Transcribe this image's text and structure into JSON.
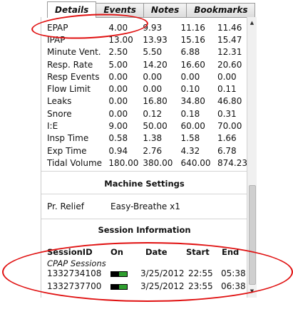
{
  "tabs": [
    "Details",
    "Events",
    "Notes",
    "Bookmarks"
  ],
  "stats": [
    {
      "label": "EPAP",
      "values": [
        "4.00",
        "9.93",
        "11.16",
        "11.46"
      ]
    },
    {
      "label": "IPAP",
      "values": [
        "13.00",
        "13.93",
        "15.16",
        "15.47"
      ]
    },
    {
      "label": "Minute Vent.",
      "values": [
        "2.50",
        "5.50",
        "6.88",
        "12.31"
      ]
    },
    {
      "label": "Resp. Rate",
      "values": [
        "5.00",
        "14.20",
        "16.60",
        "20.60"
      ]
    },
    {
      "label": "Resp Events",
      "values": [
        "0.00",
        "0.00",
        "0.00",
        "0.00"
      ]
    },
    {
      "label": "Flow Limit",
      "values": [
        "0.00",
        "0.00",
        "0.10",
        "0.11"
      ]
    },
    {
      "label": "Leaks",
      "values": [
        "0.00",
        "16.80",
        "34.80",
        "46.80"
      ]
    },
    {
      "label": "Snore",
      "values": [
        "0.00",
        "0.12",
        "0.18",
        "0.31"
      ]
    },
    {
      "label": "I:E",
      "values": [
        "9.00",
        "50.00",
        "60.00",
        "70.00"
      ]
    },
    {
      "label": "Insp Time",
      "values": [
        "0.58",
        "1.38",
        "1.58",
        "1.66"
      ]
    },
    {
      "label": "Exp Time",
      "values": [
        "0.94",
        "2.76",
        "4.32",
        "6.78"
      ]
    },
    {
      "label": "Tidal Volume",
      "values": [
        "180.00",
        "380.00",
        "640.00",
        "874.23"
      ]
    }
  ],
  "machine_settings": {
    "title": "Machine Settings",
    "label": "Pr. Relief",
    "value": "Easy-Breathe x1"
  },
  "session_info": {
    "title": "Session Information",
    "headers": {
      "id": "SessionID",
      "on": "On",
      "date": "Date",
      "start": "Start",
      "end": "End"
    },
    "group": "CPAP Sessions",
    "rows": [
      {
        "id": "1332734108",
        "date": "3/25/2012",
        "start": "22:55",
        "end": "05:38"
      },
      {
        "id": "1332737700",
        "date": "3/25/2012",
        "start": "23:55",
        "end": "06:38"
      }
    ]
  },
  "colors": {
    "annotation": "#e01010",
    "session_on": "#2e9e2e"
  }
}
